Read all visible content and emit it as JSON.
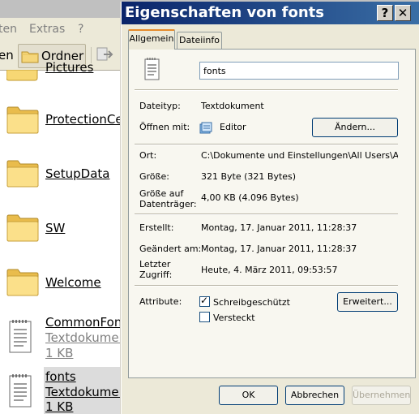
{
  "explorer": {
    "menu": {
      "item1": "ten",
      "item2": "Extras",
      "item3": "?"
    },
    "toolbar": {
      "back_label": "en",
      "folders_label": "Ordner"
    },
    "items": [
      {
        "name": "Pictures",
        "kind": "folder"
      },
      {
        "name": "ProtectionCenter",
        "kind": "folder"
      },
      {
        "name": "SetupData",
        "kind": "folder"
      },
      {
        "name": "SW",
        "kind": "folder"
      },
      {
        "name": "Welcome",
        "kind": "folder"
      },
      {
        "name": "CommonFonts",
        "kind": "file",
        "type": "Textdokument",
        "size": "1 KB"
      },
      {
        "name": "fonts",
        "kind": "file",
        "type": "Textdokument",
        "size": "1 KB",
        "selected": true
      }
    ]
  },
  "dialog": {
    "title": "Eigenschaften von fonts",
    "help_glyph": "?",
    "close_glyph": "✕",
    "tabs": {
      "general": "Allgemein",
      "fileinfo": "Dateiinfo"
    },
    "name_value": "fonts",
    "filetype_label": "Dateityp:",
    "filetype_value": "Textdokument",
    "opens_with_label": "Öffnen mit:",
    "opens_with_value": "Editor",
    "change_button": "Ändern...",
    "location_label": "Ort:",
    "location_value": "C:\\Dokumente und Einstellungen\\All Users\\Anwendungsdaten",
    "size_label": "Größe:",
    "size_value": "321 Byte (321 Bytes)",
    "size_on_disk_label_1": "Größe auf",
    "size_on_disk_label_2": "Datenträger:",
    "size_on_disk_value": "4,00 KB (4.096 Bytes)",
    "created_label": "Erstellt:",
    "created_value": "Montag, 17. Januar 2011, 11:28:37",
    "modified_label": "Geändert am:",
    "modified_value": "Montag, 17. Januar 2011, 11:28:37",
    "accessed_label_1": "Letzter",
    "accessed_label_2": "Zugriff:",
    "accessed_value": "Heute, 4. März 2011, 09:53:57",
    "attributes_label": "Attribute:",
    "readonly_label": "Schreibgeschützt",
    "readonly_checked": true,
    "hidden_label": "Versteckt",
    "hidden_checked": false,
    "advanced_button": "Erweitert...",
    "ok_button": "OK",
    "cancel_button": "Abbrechen",
    "apply_button": "Übernehmen",
    "title_bar_color": "#0a246a"
  }
}
